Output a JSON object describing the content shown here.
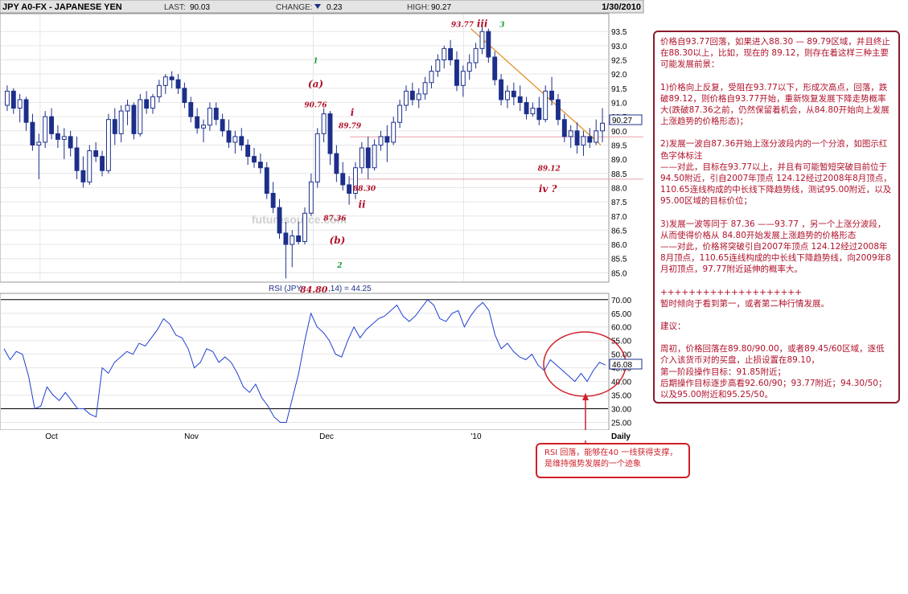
{
  "header": {
    "symbol": "JPY A0-FX - JAPANESE YEN",
    "last_label": "LAST:",
    "last_value": "90.03",
    "change_label": "CHANGE:",
    "change_value": "0.23",
    "high_label": "HIGH:",
    "high_value": "90.27",
    "date": "1/30/2010"
  },
  "colors": {
    "up": "#ffffff",
    "down": "#1c2f8a",
    "wick": "#1c2f8a",
    "trendline": "#e08a1a",
    "annotation_red": "#b0122b",
    "annotation_green": "#1a9a3a",
    "rsi_line": "#1f3fd0"
  },
  "watermark": "futuresource.com",
  "chart_data": [
    {
      "type": "candlestick",
      "title": "JPY A0-FX - JAPANESE YEN",
      "y_ticks": [
        "93.5",
        "93.0",
        "92.5",
        "92.0",
        "91.5",
        "91.0",
        "90.5",
        "90.0",
        "89.5",
        "89.0",
        "88.5",
        "88.0",
        "87.5",
        "87.0",
        "86.5",
        "86.0",
        "85.5",
        "85.0"
      ],
      "ylim": [
        84.7,
        94.1
      ],
      "last_price_label": "90.27",
      "x_ticks": [
        "Oct",
        "Nov",
        "Dec",
        "'10",
        "Daily"
      ],
      "candles": [
        {
          "o": 90.9,
          "h": 91.6,
          "l": 90.7,
          "c": 91.4
        },
        {
          "o": 91.4,
          "h": 91.5,
          "l": 90.6,
          "c": 90.8
        },
        {
          "o": 90.8,
          "h": 91.3,
          "l": 90.3,
          "c": 91.1
        },
        {
          "o": 91.1,
          "h": 91.2,
          "l": 90.0,
          "c": 90.3
        },
        {
          "o": 90.3,
          "h": 90.6,
          "l": 89.3,
          "c": 89.5
        },
        {
          "o": 89.5,
          "h": 89.9,
          "l": 88.3,
          "c": 89.6
        },
        {
          "o": 89.6,
          "h": 90.7,
          "l": 89.4,
          "c": 90.5
        },
        {
          "o": 90.5,
          "h": 90.8,
          "l": 89.7,
          "c": 89.9
        },
        {
          "o": 89.9,
          "h": 90.2,
          "l": 89.4,
          "c": 89.7
        },
        {
          "o": 89.7,
          "h": 90.1,
          "l": 89.0,
          "c": 89.8
        },
        {
          "o": 89.8,
          "h": 90.0,
          "l": 89.1,
          "c": 89.4
        },
        {
          "o": 89.4,
          "h": 89.8,
          "l": 88.3,
          "c": 88.6
        },
        {
          "o": 88.6,
          "h": 89.1,
          "l": 88.0,
          "c": 88.2
        },
        {
          "o": 88.2,
          "h": 89.5,
          "l": 88.1,
          "c": 89.3
        },
        {
          "o": 89.3,
          "h": 89.6,
          "l": 88.9,
          "c": 89.1
        },
        {
          "o": 89.1,
          "h": 89.3,
          "l": 88.4,
          "c": 88.6
        },
        {
          "o": 88.6,
          "h": 90.6,
          "l": 88.5,
          "c": 90.4
        },
        {
          "o": 90.4,
          "h": 90.8,
          "l": 89.5,
          "c": 89.9
        },
        {
          "o": 89.9,
          "h": 90.9,
          "l": 89.6,
          "c": 90.7
        },
        {
          "o": 90.7,
          "h": 91.1,
          "l": 90.2,
          "c": 90.9
        },
        {
          "o": 90.9,
          "h": 91.0,
          "l": 89.7,
          "c": 89.9
        },
        {
          "o": 89.9,
          "h": 91.3,
          "l": 89.8,
          "c": 91.1
        },
        {
          "o": 91.1,
          "h": 91.4,
          "l": 90.6,
          "c": 90.8
        },
        {
          "o": 90.8,
          "h": 91.3,
          "l": 90.6,
          "c": 91.2
        },
        {
          "o": 91.2,
          "h": 91.8,
          "l": 91.0,
          "c": 91.6
        },
        {
          "o": 91.6,
          "h": 92.0,
          "l": 91.3,
          "c": 91.9
        },
        {
          "o": 91.9,
          "h": 92.1,
          "l": 91.5,
          "c": 91.8
        },
        {
          "o": 91.8,
          "h": 92.0,
          "l": 91.3,
          "c": 91.5
        },
        {
          "o": 91.5,
          "h": 91.7,
          "l": 90.8,
          "c": 91.0
        },
        {
          "o": 91.0,
          "h": 91.2,
          "l": 90.3,
          "c": 90.5
        },
        {
          "o": 90.5,
          "h": 90.8,
          "l": 89.9,
          "c": 90.1
        },
        {
          "o": 90.1,
          "h": 90.4,
          "l": 89.6,
          "c": 90.2
        },
        {
          "o": 90.2,
          "h": 91.0,
          "l": 90.0,
          "c": 90.8
        },
        {
          "o": 90.8,
          "h": 91.0,
          "l": 90.2,
          "c": 90.4
        },
        {
          "o": 90.4,
          "h": 90.6,
          "l": 89.8,
          "c": 90.0
        },
        {
          "o": 90.0,
          "h": 90.4,
          "l": 89.4,
          "c": 89.6
        },
        {
          "o": 89.6,
          "h": 90.0,
          "l": 89.2,
          "c": 89.8
        },
        {
          "o": 89.8,
          "h": 90.1,
          "l": 89.3,
          "c": 89.5
        },
        {
          "o": 89.5,
          "h": 89.7,
          "l": 88.8,
          "c": 89.1
        },
        {
          "o": 89.1,
          "h": 89.4,
          "l": 88.7,
          "c": 88.9
        },
        {
          "o": 88.9,
          "h": 89.2,
          "l": 88.5,
          "c": 88.7
        },
        {
          "o": 88.7,
          "h": 88.9,
          "l": 87.6,
          "c": 87.8
        },
        {
          "o": 87.8,
          "h": 88.2,
          "l": 87.1,
          "c": 87.3
        },
        {
          "o": 87.3,
          "h": 87.6,
          "l": 86.2,
          "c": 86.4
        },
        {
          "o": 86.4,
          "h": 86.8,
          "l": 84.8,
          "c": 86.0
        },
        {
          "o": 86.0,
          "h": 86.5,
          "l": 85.2,
          "c": 86.3
        },
        {
          "o": 86.3,
          "h": 86.8,
          "l": 86.0,
          "c": 86.1
        },
        {
          "o": 86.1,
          "h": 87.3,
          "l": 86.0,
          "c": 87.1
        },
        {
          "o": 87.1,
          "h": 88.5,
          "l": 87.0,
          "c": 88.2
        },
        {
          "o": 88.2,
          "h": 90.1,
          "l": 88.0,
          "c": 89.9
        },
        {
          "o": 89.9,
          "h": 90.8,
          "l": 89.6,
          "c": 90.6
        },
        {
          "o": 90.6,
          "h": 90.7,
          "l": 88.8,
          "c": 89.2
        },
        {
          "o": 89.2,
          "h": 89.5,
          "l": 88.2,
          "c": 88.5
        },
        {
          "o": 88.5,
          "h": 88.9,
          "l": 87.9,
          "c": 88.1
        },
        {
          "o": 88.1,
          "h": 88.4,
          "l": 87.4,
          "c": 87.8
        },
        {
          "o": 87.8,
          "h": 88.9,
          "l": 87.6,
          "c": 88.7
        },
        {
          "o": 88.7,
          "h": 89.6,
          "l": 88.5,
          "c": 89.4
        },
        {
          "o": 89.4,
          "h": 89.8,
          "l": 88.3,
          "c": 88.7
        },
        {
          "o": 88.7,
          "h": 89.7,
          "l": 88.6,
          "c": 89.5
        },
        {
          "o": 89.5,
          "h": 90.0,
          "l": 89.3,
          "c": 89.8
        },
        {
          "o": 89.8,
          "h": 90.2,
          "l": 88.9,
          "c": 89.6
        },
        {
          "o": 89.6,
          "h": 90.5,
          "l": 89.5,
          "c": 90.3
        },
        {
          "o": 90.3,
          "h": 91.1,
          "l": 90.1,
          "c": 90.9
        },
        {
          "o": 90.9,
          "h": 91.6,
          "l": 90.7,
          "c": 91.4
        },
        {
          "o": 91.4,
          "h": 91.7,
          "l": 90.9,
          "c": 91.1
        },
        {
          "o": 91.1,
          "h": 91.5,
          "l": 90.8,
          "c": 91.3
        },
        {
          "o": 91.3,
          "h": 91.9,
          "l": 91.1,
          "c": 91.7
        },
        {
          "o": 91.7,
          "h": 92.3,
          "l": 91.5,
          "c": 92.1
        },
        {
          "o": 92.1,
          "h": 92.7,
          "l": 91.9,
          "c": 92.5
        },
        {
          "o": 92.5,
          "h": 93.0,
          "l": 92.2,
          "c": 92.9
        },
        {
          "o": 92.9,
          "h": 93.2,
          "l": 92.3,
          "c": 92.5
        },
        {
          "o": 92.5,
          "h": 92.8,
          "l": 91.4,
          "c": 91.6
        },
        {
          "o": 91.6,
          "h": 92.3,
          "l": 91.2,
          "c": 92.1
        },
        {
          "o": 92.1,
          "h": 92.7,
          "l": 91.8,
          "c": 92.4
        },
        {
          "o": 92.4,
          "h": 93.1,
          "l": 92.2,
          "c": 92.9
        },
        {
          "o": 92.9,
          "h": 93.77,
          "l": 92.7,
          "c": 93.5
        },
        {
          "o": 93.5,
          "h": 93.6,
          "l": 92.4,
          "c": 92.6
        },
        {
          "o": 92.6,
          "h": 92.8,
          "l": 91.6,
          "c": 91.8
        },
        {
          "o": 91.8,
          "h": 92.0,
          "l": 90.9,
          "c": 91.1
        },
        {
          "o": 91.1,
          "h": 91.6,
          "l": 90.8,
          "c": 91.4
        },
        {
          "o": 91.4,
          "h": 91.7,
          "l": 90.9,
          "c": 91.2
        },
        {
          "o": 91.2,
          "h": 91.6,
          "l": 90.7,
          "c": 91.0
        },
        {
          "o": 91.0,
          "h": 91.2,
          "l": 90.4,
          "c": 90.6
        },
        {
          "o": 90.6,
          "h": 91.0,
          "l": 90.5,
          "c": 90.8
        },
        {
          "o": 90.8,
          "h": 91.2,
          "l": 90.2,
          "c": 90.4
        },
        {
          "o": 90.4,
          "h": 91.6,
          "l": 90.3,
          "c": 91.4
        },
        {
          "o": 91.4,
          "h": 91.9,
          "l": 90.9,
          "c": 91.1
        },
        {
          "o": 91.1,
          "h": 91.3,
          "l": 90.2,
          "c": 90.4
        },
        {
          "o": 90.4,
          "h": 90.6,
          "l": 89.6,
          "c": 89.8
        },
        {
          "o": 89.8,
          "h": 90.2,
          "l": 89.4,
          "c": 90.0
        },
        {
          "o": 90.0,
          "h": 90.3,
          "l": 89.2,
          "c": 89.5
        },
        {
          "o": 89.5,
          "h": 90.0,
          "l": 89.12,
          "c": 89.8
        },
        {
          "o": 89.8,
          "h": 90.1,
          "l": 89.4,
          "c": 89.6
        },
        {
          "o": 89.6,
          "h": 90.4,
          "l": 89.5,
          "c": 90.0
        },
        {
          "o": 90.0,
          "h": 90.8,
          "l": 89.6,
          "c": 90.27
        }
      ],
      "annotations": [
        {
          "text": "93.77",
          "x": 76.2,
          "y": 93.77,
          "color": "red"
        },
        {
          "text": "iii",
          "x": 79.5,
          "y": 93.77,
          "color": "red"
        },
        {
          "text": "3",
          "x": 82.8,
          "y": 93.77,
          "color": "green"
        },
        {
          "text": "1",
          "x": 51.8,
          "y": 92.5,
          "color": "green"
        },
        {
          "text": "(a)",
          "x": 51.8,
          "y": 91.65,
          "color": "red"
        },
        {
          "text": "90.76",
          "x": 51.8,
          "y": 90.95,
          "color": "red"
        },
        {
          "text": "i",
          "x": 57.9,
          "y": 90.65,
          "color": "red"
        },
        {
          "text": "89.79",
          "x": 57.5,
          "y": 90.2,
          "color": "red"
        },
        {
          "text": "88.30",
          "x": 59.9,
          "y": 88.0,
          "color": "red"
        },
        {
          "text": "ii",
          "x": 59.5,
          "y": 87.4,
          "color": "red"
        },
        {
          "text": "87.36",
          "x": 55.0,
          "y": 86.95,
          "color": "red"
        },
        {
          "text": "(b)",
          "x": 55.4,
          "y": 86.15,
          "color": "red"
        },
        {
          "text": "2",
          "x": 55.8,
          "y": 85.3,
          "color": "green"
        },
        {
          "text": "89.12",
          "x": 90.6,
          "y": 88.7,
          "color": "red"
        },
        {
          "text": "iv ?",
          "x": 90.4,
          "y": 87.95,
          "color": "red"
        }
      ],
      "trendline": {
        "from": [
          77.6,
          93.6
        ],
        "to": [
          99.2,
          89.5
        ]
      },
      "levels": [
        89.79,
        88.3
      ]
    },
    {
      "type": "line",
      "title": "RSI (JPY",
      "title_overlay": "84.80",
      "title_suffix": ",14) = 44.25",
      "y_ticks": [
        "70.00",
        "65.00",
        "60.00",
        "55.00",
        "50.00",
        "45.00",
        "40.00",
        "35.00",
        "30.00",
        "25.00"
      ],
      "ylim": [
        22.5,
        72.0
      ],
      "last_value_label": "46.08",
      "reference_lines": [
        70,
        30
      ],
      "values": [
        52,
        48,
        51,
        50,
        42,
        30,
        31,
        38,
        35,
        33,
        36,
        33,
        30,
        30,
        28,
        27,
        45,
        43,
        47,
        49,
        51,
        50,
        54,
        53,
        56,
        59,
        63,
        61,
        57,
        56,
        52,
        45,
        47,
        52,
        51,
        47,
        49,
        47,
        43,
        38,
        36,
        39,
        34,
        31,
        27,
        25,
        25,
        34,
        43,
        55,
        65,
        60,
        58,
        55,
        50,
        49,
        55,
        60,
        56,
        59,
        61,
        63,
        64,
        66,
        68,
        64,
        62,
        64,
        67,
        70,
        68,
        63,
        62,
        65,
        66,
        60,
        64,
        67,
        69,
        66,
        57,
        52,
        54,
        51,
        49,
        48,
        50,
        46,
        44,
        48,
        46,
        44,
        42,
        40,
        43,
        40,
        44,
        47,
        46
      ]
    }
  ],
  "note": {
    "intro": "价格自93.77回落，如果进入88.30 — 89.79区域，并且终止在88.30以上，比如，现在的 89.12，则存在着这样三种主要可能发展前景：",
    "s1": "1)价格向上反复，受阻在93.77以下，形成次高点，回落，跌破89.12，则价格自93.77开始，重新恢复发展下降走势概率大(跌破87.36之前，仍然保留着机会，从84.80开始向上发展上涨趋势的价格形态)；",
    "s2a": "2)发展一波自87.36开始上涨分波段内的一个分浪，如图示红色字体标注",
    "s2b": "——对此，目标在93.77以上，并且有可能暂短突破目前位于94.50附近，引自2007年顶点 124.12经过2008年8月顶点，110.65连线构成的中长线下降趋势线，测试95.00附近，以及95.00区域的目标价位；",
    "s3a": "3)发展一波等同于 87.36 ——93.77 ，另一个上涨分波段，从而使得价格从 84.80开始发展上涨趋势的价格形态",
    "s3b": "——对此，价格将突破引自2007年顶点 124.12经过2008年8月顶点，110.65连线构成的中长线下降趋势线，向2009年8月初顶点，97.77附近延伸的概率大。",
    "separator": "++++++++++++++++++++",
    "lean": "暂时倾向于看到第一，或者第二种行情发展。",
    "advice_title": "建议：",
    "advice1": "周初，价格回落在89.80/90.00，或者89.45/60区域，逐低介入该货币对的买盘，止损设置在89.10，",
    "advice2": "第一阶段操作目标：91.85附近；",
    "advice3": "后期操作目标逐步高看92.60/90；93.77附近；94.30/50；",
    "advice4": "以及95.00附近和95.25/50。"
  },
  "callout": {
    "line1": "RSI 回落，能够在40 一线获得支撑，",
    "line2": "是维持强势发展的一个迹象"
  }
}
